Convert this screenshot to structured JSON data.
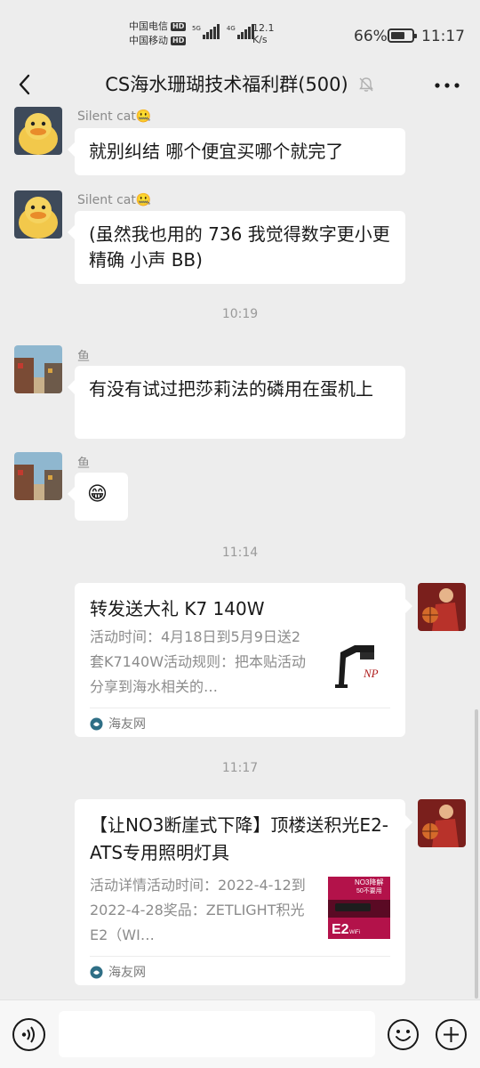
{
  "status_bar": {
    "carrier1": "中国电信",
    "carrier2": "中国移动",
    "hd": "HD",
    "net1": "5G",
    "net2": "4G",
    "speed_value": "12.1",
    "speed_unit": "K/s",
    "battery_percent": "66%",
    "battery_level": 0.66,
    "time": "11:17"
  },
  "nav": {
    "title": "CS海水珊瑚技术福利群(500)"
  },
  "messages": {
    "m1": {
      "sender": "Silent cat🤐",
      "text": "就别纠结 哪个便宜买哪个就完了"
    },
    "m2": {
      "sender": "Silent cat🤐",
      "text": "(虽然我也用的 736 我觉得数字更小更精确 小声 BB)"
    },
    "ts1": "10:19",
    "m3": {
      "sender": "鱼",
      "text": "有没有试过把莎莉法的磷用在蛋机上"
    },
    "m4": {
      "sender": "鱼",
      "text": "😁"
    },
    "ts2": "11:14",
    "card1": {
      "title": "转发送大礼 K7 140W",
      "desc": "活动时间：4月18日到5月9日送2套K7140W活动规则：把本贴活动分享到海水相关的…",
      "source": "海友网",
      "thumb_text": "NP"
    },
    "ts3": "11:17",
    "card2": {
      "title": "【让NO3断崖式下降】顶楼送积光E2-ATS专用照明灯具",
      "desc": "活动详情活动时间：2022-4-12到2022-4-28奖品：ZETLIGHT积光E2（WI…",
      "source": "海友网",
      "thumb_line1": "NO3降解",
      "thumb_line2": "50不要用",
      "thumb_big": "E2",
      "thumb_small": "WiFi"
    }
  },
  "input": {
    "placeholder": ""
  }
}
